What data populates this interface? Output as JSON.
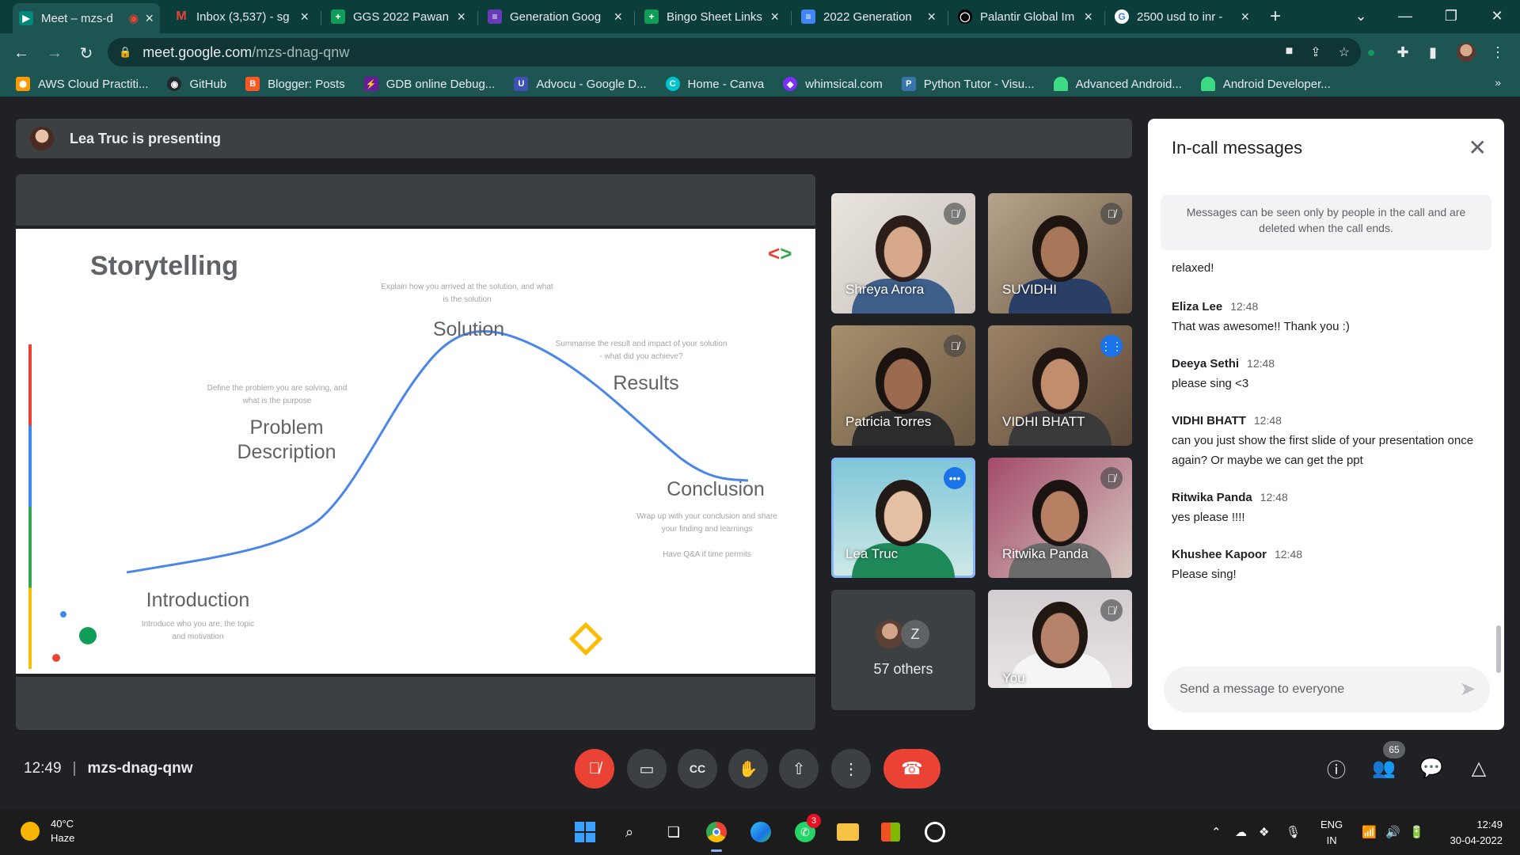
{
  "browser": {
    "tabs": [
      {
        "label": "Meet – mzs-d",
        "icon": "meet-icon",
        "color": "#00897b"
      },
      {
        "label": "Inbox (3,537) - sg",
        "icon": "gmail-icon",
        "color": "#ea4335"
      },
      {
        "label": "GGS 2022 Pawan",
        "icon": "sheets-icon",
        "color": "#0f9d58"
      },
      {
        "label": "Generation Goog",
        "icon": "forms-icon",
        "color": "#673ab7"
      },
      {
        "label": "Bingo Sheet Links",
        "icon": "sheets-icon",
        "color": "#0f9d58"
      },
      {
        "label": "2022 Generation",
        "icon": "docs-icon",
        "color": "#4285f4"
      },
      {
        "label": "Palantir Global Im",
        "icon": "palantir-icon",
        "color": "#000000"
      },
      {
        "label": "2500 usd to inr -",
        "icon": "google-icon",
        "color": "#ffffff"
      }
    ],
    "new_tab": "+",
    "url_host": "meet.google.com",
    "url_path": "/mzs-dnag-qnw",
    "bookmarks": [
      {
        "label": "AWS Cloud Practiti...",
        "icon": "aws-icon",
        "color": "#ff9900"
      },
      {
        "label": "GitHub",
        "icon": "github-icon",
        "color": "#24292e"
      },
      {
        "label": "Blogger: Posts",
        "icon": "blogger-icon",
        "color": "#ff5722"
      },
      {
        "label": "GDB online Debug...",
        "icon": "gdb-icon",
        "color": "#6a1b9a"
      },
      {
        "label": "Advocu - Google D...",
        "icon": "advocu-icon",
        "color": "#3f51b5"
      },
      {
        "label": "Home - Canva",
        "icon": "canva-icon",
        "color": "#00c4cc"
      },
      {
        "label": "whimsical.com",
        "icon": "whimsical-icon",
        "color": "#7b2ff7"
      },
      {
        "label": "Python Tutor - Visu...",
        "icon": "python-icon",
        "color": "#3776ab"
      },
      {
        "label": "Advanced Android...",
        "icon": "android-icon",
        "color": "#3ddc84"
      },
      {
        "label": "Android Developer...",
        "icon": "android-icon",
        "color": "#3ddc84"
      }
    ]
  },
  "meet": {
    "presenting_text": "Lea Truc is presenting",
    "slide": {
      "title": "Storytelling",
      "stages": [
        {
          "label": "Introduction",
          "note": "Introduce who you are, the topic and motivation"
        },
        {
          "label": "Problem Description",
          "note": "Define the problem you are solving, and what is the purpose"
        },
        {
          "label": "Solution",
          "note": "Explain how you arrived at the solution, and what is the solution"
        },
        {
          "label": "Results",
          "note": "Summarise the result and impact of your solution - what did you achieve?"
        },
        {
          "label": "Conclusion",
          "note": "Wrap up with your conclusion and share your finding and learnings"
        }
      ],
      "extra_note": "Have Q&A if time permits"
    },
    "participants": [
      {
        "name": "Shreya Arora",
        "muted": true
      },
      {
        "name": "SUVIDHI",
        "muted": true
      },
      {
        "name": "Patricia Torres",
        "muted": true
      },
      {
        "name": "VIDHI BHATT",
        "muted": false
      },
      {
        "name": "Lea Truc",
        "muted": false
      },
      {
        "name": "Ritwika Panda",
        "muted": true
      },
      {
        "name": "You",
        "muted": true
      }
    ],
    "others": {
      "initial": "Z",
      "label": "57 others"
    },
    "chat": {
      "title": "In-call messages",
      "notice": "Messages can be seen only by people in the call and are deleted when the call ends.",
      "partial": "relaxed!",
      "messages": [
        {
          "sender": "Eliza Lee",
          "time": "12:48",
          "text": "That was awesome!! Thank you :)"
        },
        {
          "sender": "Deeya Sethi",
          "time": "12:48",
          "text": "please sing <3"
        },
        {
          "sender": "VIDHI BHATT",
          "time": "12:48",
          "text": "can you just show the first slide of your presentation once again? Or maybe we can get the ppt"
        },
        {
          "sender": "Ritwika Panda",
          "time": "12:48",
          "text": "yes please !!!!"
        },
        {
          "sender": "Khushee Kapoor",
          "time": "12:48",
          "text": "Please sing!"
        }
      ],
      "input_placeholder": "Send a message to everyone"
    },
    "bottom": {
      "time": "12:49",
      "meeting_code": "mzs-dnag-qnw",
      "people_count": "65"
    }
  },
  "taskbar": {
    "temperature": "40°C",
    "condition": "Haze",
    "whatsapp_badge": "3",
    "lang_top": "ENG",
    "lang_bottom": "IN",
    "clock_time": "12:49",
    "clock_date": "30-04-2022"
  }
}
